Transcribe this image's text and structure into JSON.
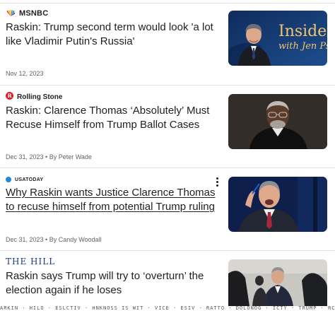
{
  "articles": [
    {
      "source": "MSNBC",
      "source_icon": "nbc-peacock-icon",
      "headline": "Raskin: Trump second term would look 'a lot like Vladimir Putin's Russia'",
      "meta": "Nov 12, 2023",
      "thumbnail_text_1": "Inside",
      "thumbnail_text_2": "with Jen Psaki"
    },
    {
      "source": "Rolling Stone",
      "source_icon": "rolling-stone-icon",
      "headline": "Raskin: Clarence Thomas ‘Absolutely’ Must Recuse Himself from Trump Ballot Cases",
      "meta": "Dec 31, 2023 • By Peter Wade"
    },
    {
      "source": "USATODAY",
      "source_icon": "usa-today-dot-icon",
      "headline": "Why Raskin wants Justice Clarence Thomas to recuse himself from potential Trump ruling",
      "meta": "Dec 31, 2023 • By Candy Woodall"
    },
    {
      "source": "THE HILL",
      "headline": "Raskin says Trump will try to ‘overturn’ the election again if he loses"
    }
  ],
  "colors": {
    "msnbc_red": "#e8322a",
    "msnbc_orange": "#f6a21a",
    "msnbc_yellow": "#f7d117",
    "msnbc_green": "#1fa24b",
    "msnbc_blue": "#1a73c8",
    "msnbc_purple": "#6a3b9a",
    "rolling_stone_red": "#d9242a",
    "usa_today_blue": "#1f8ad6",
    "hill_navy": "#1a3a8a"
  },
  "ticker": "ARKIN · HILO · ESLCTIV · HNKNOSS IS WIT · VICE · ESIV · RATTO · DOLONOG · ICTY · TRUMP · RCT · OUESSERS · O VESKE · ON · MUNICTO · ELECT"
}
